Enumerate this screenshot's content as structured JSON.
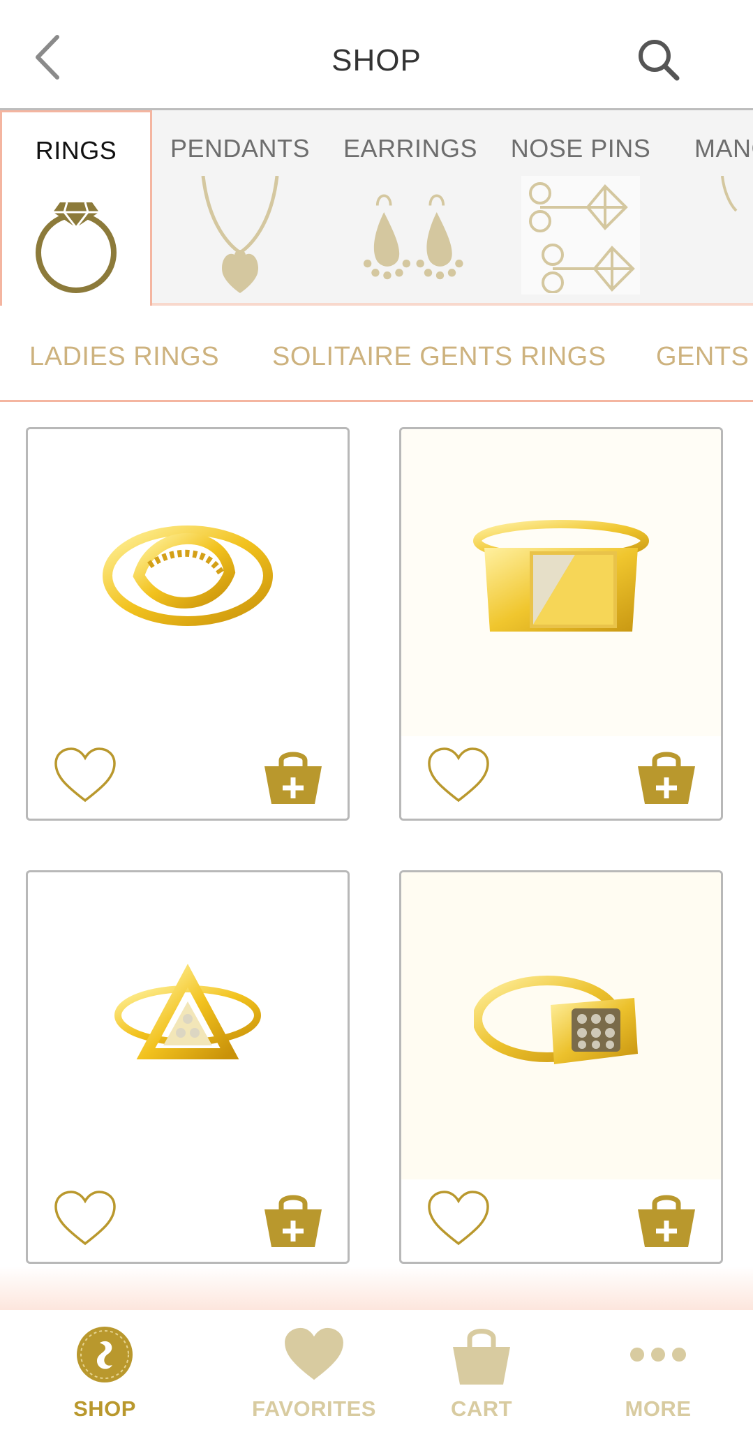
{
  "header": {
    "title": "SHOP"
  },
  "categories": [
    {
      "label": "RINGS",
      "icon": "ring-icon",
      "active": true
    },
    {
      "label": "PENDANTS",
      "icon": "pendant-icon",
      "active": false
    },
    {
      "label": "EARRINGS",
      "icon": "earrings-icon",
      "active": false
    },
    {
      "label": "NOSE PINS",
      "icon": "nose-pin-icon",
      "active": false
    },
    {
      "label": "MANG",
      "icon": "mangalsutra-icon",
      "active": false
    }
  ],
  "subcategories": [
    "LADIES RINGS",
    "SOLITAIRE GENTS RINGS",
    "GENTS"
  ],
  "products": [
    {
      "image": "gold-knot-ladies-ring",
      "favorite": false
    },
    {
      "image": "gold-gents-ring-stone-triangle",
      "favorite": false
    },
    {
      "image": "gold-triangle-stone-ring",
      "favorite": false
    },
    {
      "image": "gold-gents-ring-square-stone",
      "favorite": false
    }
  ],
  "nav": [
    {
      "label": "SHOP",
      "icon": "shop-logo-icon",
      "active": true
    },
    {
      "label": "FAVORITES",
      "icon": "heart-icon",
      "active": false
    },
    {
      "label": "CART",
      "icon": "basket-icon",
      "active": false
    },
    {
      "label": "MORE",
      "icon": "more-dots-icon",
      "active": false
    }
  ],
  "colors": {
    "gold": "#b9982d",
    "gold_light": "#d8cba0",
    "accent_peach": "#f4b5a0",
    "subcategory_text": "#cdb27e"
  }
}
